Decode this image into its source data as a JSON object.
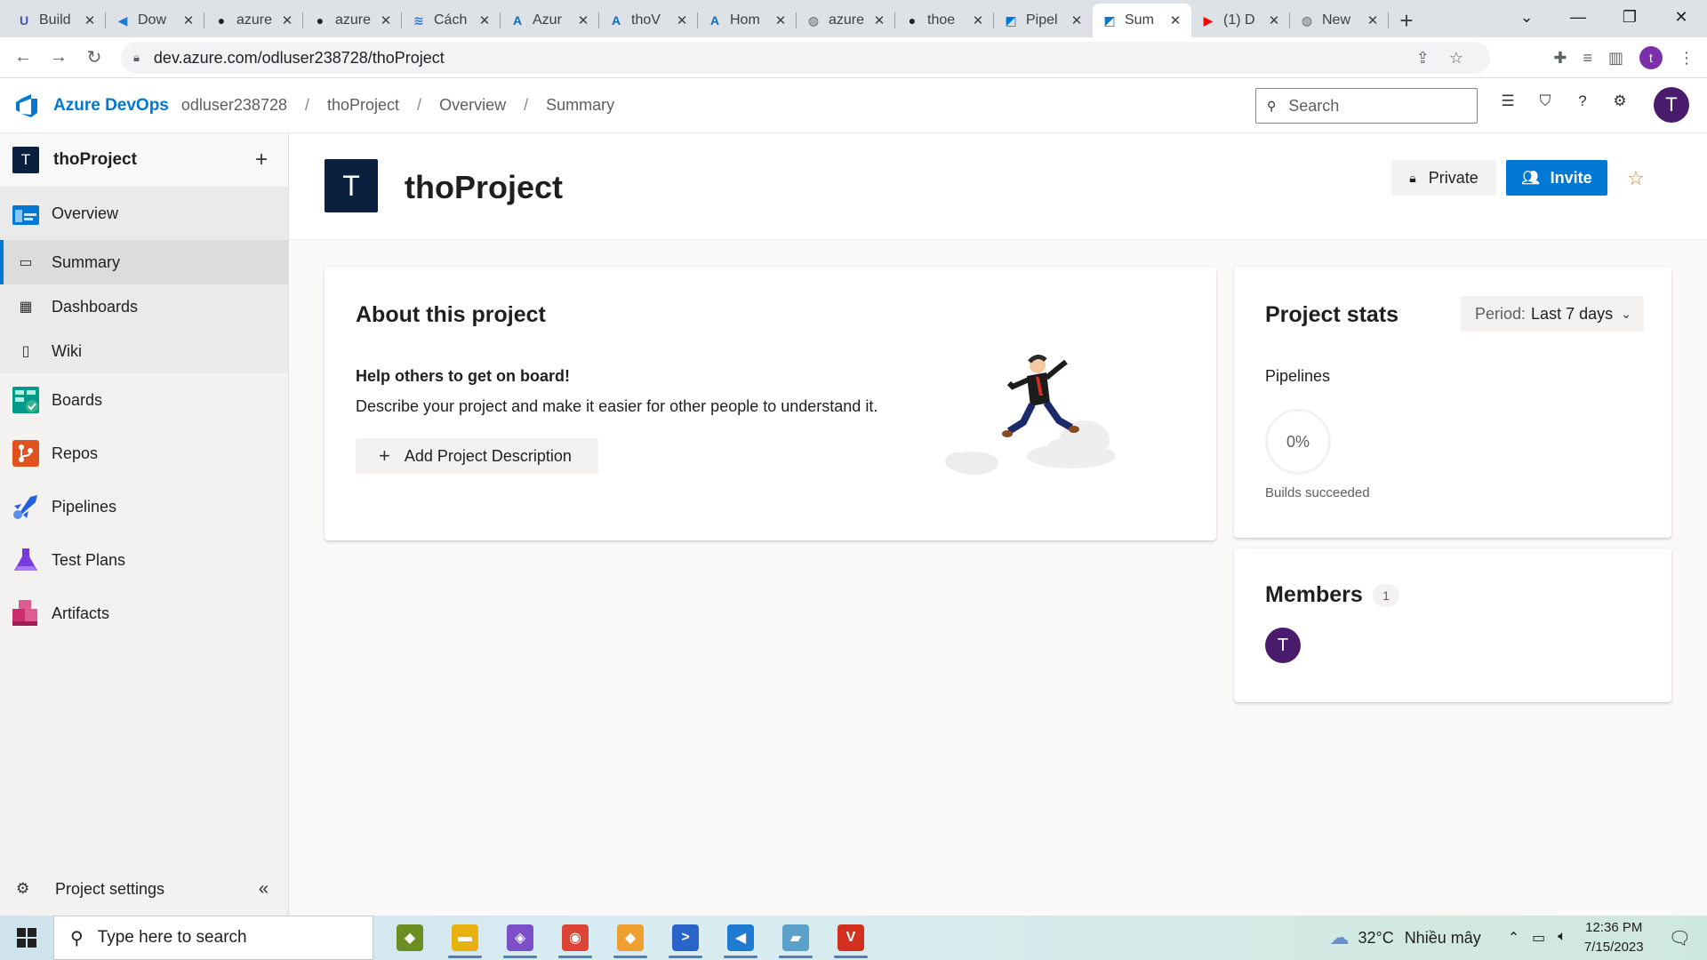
{
  "browser": {
    "tabs": [
      {
        "label": "Build",
        "icon": "bolt-icon",
        "color": "#4b53bc",
        "glyph": "U"
      },
      {
        "label": "Dow",
        "icon": "vscode-icon",
        "color": "#1f7bd1",
        "glyph": "◀"
      },
      {
        "label": "azure",
        "icon": "github-icon",
        "color": "#1f2328",
        "glyph": "●"
      },
      {
        "label": "azure",
        "icon": "github-icon",
        "color": "#1f2328",
        "glyph": "●"
      },
      {
        "label": "Cách",
        "icon": "stack-icon",
        "color": "#2a7fd4",
        "glyph": "≋"
      },
      {
        "label": "Azur",
        "icon": "azure-icon",
        "color": "#0f6cbd",
        "glyph": "A"
      },
      {
        "label": "thoV",
        "icon": "azure-icon",
        "color": "#0f6cbd",
        "glyph": "A"
      },
      {
        "label": "Hom",
        "icon": "azure-icon",
        "color": "#0f6cbd",
        "glyph": "A"
      },
      {
        "label": "azure",
        "icon": "globe-icon",
        "color": "#5f6368",
        "glyph": "◍"
      },
      {
        "label": "thoe",
        "icon": "github-icon",
        "color": "#1f2328",
        "glyph": "●"
      },
      {
        "label": "Pipel",
        "icon": "devops-icon",
        "color": "#0078d4",
        "glyph": "◩"
      },
      {
        "label": "Sum",
        "icon": "devops-icon",
        "color": "#0078d4",
        "glyph": "◩",
        "active": true
      },
      {
        "label": "(1) D",
        "icon": "youtube-icon",
        "color": "#ff0000",
        "glyph": "▶"
      },
      {
        "label": "New",
        "icon": "chrome-icon",
        "color": "#5f6368",
        "glyph": "◍"
      }
    ],
    "url": "dev.azure.com/odluser238728/thoProject",
    "profile_initial": "t"
  },
  "header": {
    "brand": "Azure DevOps",
    "org": "odluser238728",
    "breadcrumbs": [
      "thoProject",
      "Overview",
      "Summary"
    ],
    "search_placeholder": "Search",
    "avatar_initial": "T"
  },
  "sidebar": {
    "project_initial": "T",
    "project_name": "thoProject",
    "items": [
      {
        "label": "Overview",
        "icon": "overview-icon",
        "color": "#0078d4"
      },
      {
        "label": "Summary",
        "icon": "summary-icon",
        "sub": true,
        "selected": true
      },
      {
        "label": "Dashboards",
        "icon": "dashboards-icon",
        "sub": true
      },
      {
        "label": "Wiki",
        "icon": "wiki-icon",
        "sub": true
      },
      {
        "label": "Boards",
        "icon": "boards-icon",
        "color": "#009a8a"
      },
      {
        "label": "Repos",
        "icon": "repos-icon",
        "color": "#e0531f"
      },
      {
        "label": "Pipelines",
        "icon": "pipelines-icon",
        "color": "#2560e0"
      },
      {
        "label": "Test Plans",
        "icon": "testplans-icon",
        "color": "#773adc"
      },
      {
        "label": "Artifacts",
        "icon": "artifacts-icon",
        "color": "#cb2e6d"
      }
    ],
    "footer_label": "Project settings"
  },
  "main": {
    "project_initial": "T",
    "title": "thoProject",
    "private_label": "Private",
    "invite_label": "Invite",
    "about": {
      "title": "About this project",
      "help_title": "Help others to get on board!",
      "help_text": "Describe your project and make it easier for other people to understand it.",
      "add_button": "Add Project Description"
    },
    "stats": {
      "title": "Project stats",
      "period_prefix": "Period:",
      "period_value": "Last 7 days",
      "pipelines_label": "Pipelines",
      "percent": "0%",
      "builds_label": "Builds succeeded"
    },
    "members": {
      "title": "Members",
      "count": "1",
      "initial": "T"
    }
  },
  "taskbar": {
    "search_placeholder": "Type here to search",
    "apps": [
      {
        "name": "maps-app",
        "color": "#6b8e23",
        "glyph": "◆",
        "running": false
      },
      {
        "name": "file-explorer",
        "color": "#e8b10e",
        "glyph": "▬",
        "running": true
      },
      {
        "name": "visual-studio",
        "color": "#7b4fc8",
        "glyph": "◈",
        "running": true
      },
      {
        "name": "chrome",
        "color": "#db4437",
        "glyph": "◉",
        "running": true
      },
      {
        "name": "git-tool",
        "color": "#f0a030",
        "glyph": "◆",
        "running": true
      },
      {
        "name": "powershell",
        "color": "#2a64c8",
        "glyph": ">",
        "running": true
      },
      {
        "name": "vscode",
        "color": "#1f7bd1",
        "glyph": "◀",
        "running": true
      },
      {
        "name": "notes-app",
        "color": "#5aa0c8",
        "glyph": "▰",
        "running": true
      },
      {
        "name": "red-app",
        "color": "#d4301f",
        "glyph": "V",
        "running": true
      }
    ],
    "temperature": "32°C",
    "weather": "Nhiều mây",
    "time": "12:36 PM",
    "date": "7/15/2023"
  }
}
